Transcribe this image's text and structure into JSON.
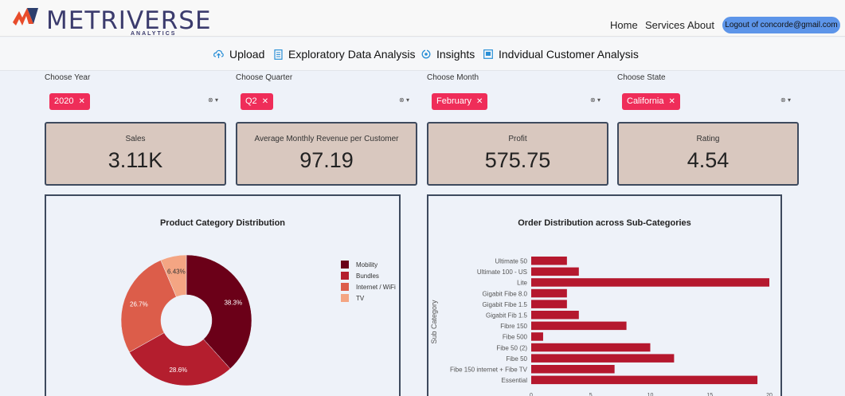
{
  "header": {
    "logo_text": "METRIVERSE",
    "logo_sub": "ANALYTICS",
    "nav": [
      "Home",
      "Services",
      "About"
    ],
    "logout_label": "Logout of concorde@gmail.com"
  },
  "tabs": [
    {
      "label": "Upload",
      "icon": "cloud-upload-icon"
    },
    {
      "label": "Exploratory Data Analysis",
      "icon": "document-icon"
    },
    {
      "label": "Insights",
      "icon": "insights-icon"
    },
    {
      "label": "Indvidual Customer Analysis",
      "icon": "monitor-icon"
    }
  ],
  "filters": [
    {
      "label": "Choose Year",
      "value": "2020"
    },
    {
      "label": "Choose Quarter",
      "value": "Q2"
    },
    {
      "label": "Choose Month",
      "value": "February"
    },
    {
      "label": "Choose State",
      "value": "California"
    }
  ],
  "kpis": [
    {
      "title": "Sales",
      "value": "3.11K"
    },
    {
      "title": "Average Monthly Revenue per Customer",
      "value": "97.19"
    },
    {
      "title": "Profit",
      "value": "575.75"
    },
    {
      "title": "Rating",
      "value": "4.54"
    }
  ],
  "colors": {
    "chip": "#ef2d59",
    "card_bg": "#d9c8bf",
    "bar": "#b5182e",
    "mobility": "#6b0018",
    "bundles": "#b41e2e",
    "internet": "#dc5d4a",
    "tv": "#f4a583"
  },
  "chart_data": [
    {
      "type": "pie",
      "title": "Product Category Distribution",
      "donut": true,
      "labels": [
        "Mobility",
        "Bundles",
        "Internet / WiFi",
        "TV"
      ],
      "values": [
        38.3,
        28.6,
        26.7,
        6.43
      ],
      "value_labels": [
        "38.3%",
        "28.6%",
        "26.7%",
        "6.43%"
      ],
      "legend_position": "right"
    },
    {
      "type": "bar",
      "orientation": "horizontal",
      "title": "Order Distribution across Sub-Categories",
      "ylabel": "Sub Category",
      "categories": [
        "Ultimate 50",
        "Ultimate 100 - US",
        "Lite",
        "Gigabit Fibe 8.0",
        "Gigabit Fibe 1.5",
        "Gigabit Fib 1.5",
        "Fibre 150",
        "Fibe 500",
        "Fibe 50 (2)",
        "Fibe 50",
        "Fibe 150 internet + Fibe TV",
        "Essential"
      ],
      "values": [
        3,
        4,
        20,
        3,
        3,
        4,
        8,
        1,
        10,
        12,
        7,
        19
      ],
      "xlim": [
        0,
        20
      ],
      "xticks": [
        "0",
        "5",
        "10",
        "15",
        "20"
      ]
    }
  ]
}
